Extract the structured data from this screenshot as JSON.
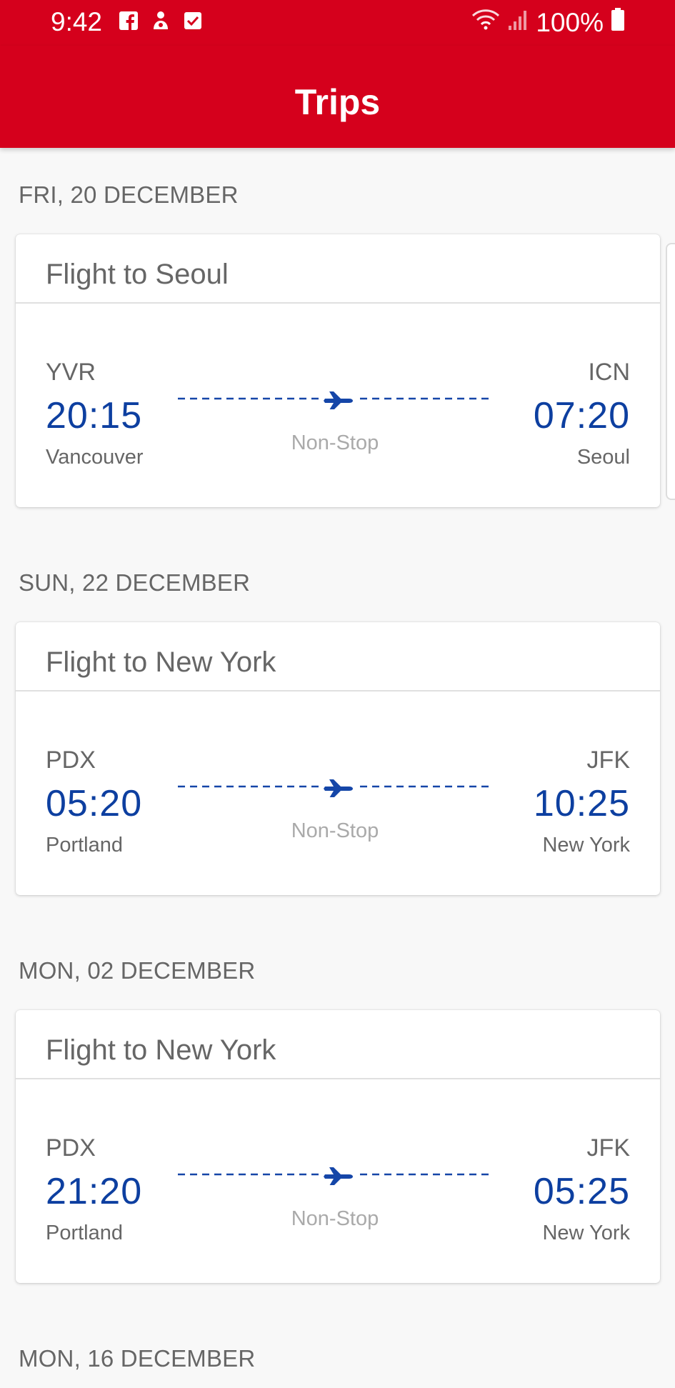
{
  "status_bar": {
    "time": "9:42",
    "battery": "100%"
  },
  "app_bar": {
    "title": "Trips"
  },
  "trips": [
    {
      "date": "FRI, 20 DECEMBER",
      "title": "Flight to Seoul",
      "origin": {
        "code": "YVR",
        "time": "20:15",
        "city": "Vancouver"
      },
      "destination": {
        "code": "ICN",
        "time": "07:20",
        "city": "Seoul"
      },
      "stops": "Non-Stop"
    },
    {
      "date": "SUN, 22 DECEMBER",
      "title": "Flight to New York",
      "origin": {
        "code": "PDX",
        "time": "05:20",
        "city": "Portland"
      },
      "destination": {
        "code": "JFK",
        "time": "10:25",
        "city": "New York"
      },
      "stops": "Non-Stop"
    },
    {
      "date": "MON, 02 DECEMBER",
      "title": "Flight to New York",
      "origin": {
        "code": "PDX",
        "time": "21:20",
        "city": "Portland"
      },
      "destination": {
        "code": "JFK",
        "time": "05:25",
        "city": "New York"
      },
      "stops": "Non-Stop"
    },
    {
      "date": "MON, 16 DECEMBER"
    }
  ],
  "colors": {
    "brand_red": "#d5001c",
    "time_blue": "#0d3fa0",
    "route_line": "#1546a8"
  },
  "icons": {
    "status_left": [
      "facebook-icon",
      "notification-icon",
      "checkbox-icon"
    ],
    "status_right": [
      "wifi-icon",
      "signal-icon",
      "battery-icon"
    ],
    "route": "airplane-icon"
  }
}
